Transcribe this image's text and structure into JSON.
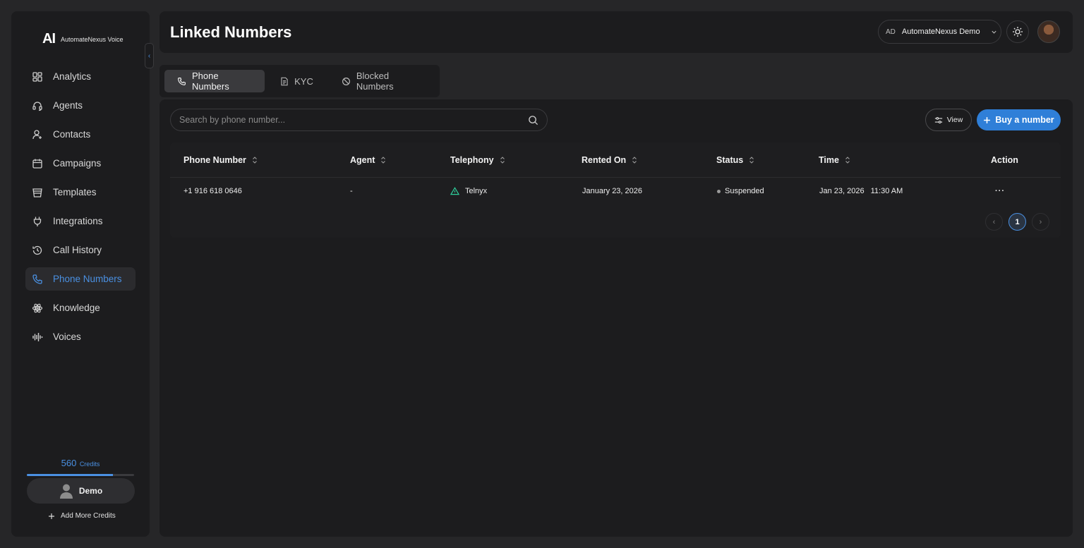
{
  "brand": {
    "mark": "AI",
    "name": "AutomateNexus Voice"
  },
  "sidebar": {
    "collapse_glyph": "‹",
    "items": [
      {
        "label": "Analytics",
        "icon": "analytics-icon",
        "active": false
      },
      {
        "label": "Agents",
        "icon": "headset-icon",
        "active": false
      },
      {
        "label": "Contacts",
        "icon": "contacts-icon",
        "active": false
      },
      {
        "label": "Campaigns",
        "icon": "calendar-icon",
        "active": false
      },
      {
        "label": "Templates",
        "icon": "templates-icon",
        "active": false
      },
      {
        "label": "Integrations",
        "icon": "plug-icon",
        "active": false
      },
      {
        "label": "Call History",
        "icon": "history-icon",
        "active": false
      },
      {
        "label": "Phone Numbers",
        "icon": "phone-icon",
        "active": true
      },
      {
        "label": "Knowledge",
        "icon": "atom-icon",
        "active": false
      },
      {
        "label": "Voices",
        "icon": "waveform-icon",
        "active": false
      }
    ],
    "credits": {
      "value": "560",
      "label": "Credits",
      "fill_fraction": 0.8
    },
    "user": {
      "name": "Demo"
    },
    "add_credits_label": "Add More Credits"
  },
  "header": {
    "title": "Linked Numbers",
    "org": {
      "abbr": "AD",
      "name": "AutomateNexus Demo"
    }
  },
  "tabs": [
    {
      "label": "Phone Numbers",
      "icon": "phone-icon",
      "active": true
    },
    {
      "label": "KYC",
      "icon": "document-icon",
      "active": false
    },
    {
      "label": "Blocked Numbers",
      "icon": "block-icon",
      "active": false
    }
  ],
  "toolbar": {
    "search_placeholder": "Search by phone number...",
    "view_label": "View",
    "buy_label": "Buy a number"
  },
  "table": {
    "columns": [
      "Phone Number",
      "Agent",
      "Telephony",
      "Rented On",
      "Status",
      "Time",
      "Action"
    ],
    "rows": [
      {
        "phone": "+1 916 618 0646",
        "agent": "-",
        "telephony": "Telnyx",
        "rented_on": "January 23, 2026",
        "status": "Suspended",
        "date": "Jan 23, 2026",
        "time": "11:30 AM",
        "action": "···"
      }
    ]
  },
  "pagination": {
    "current": "1",
    "prev": "‹",
    "next": "›"
  },
  "colors": {
    "accent": "#2f7fd8",
    "link_active": "#4a90e2",
    "telnyx": "#2ecc9a"
  }
}
